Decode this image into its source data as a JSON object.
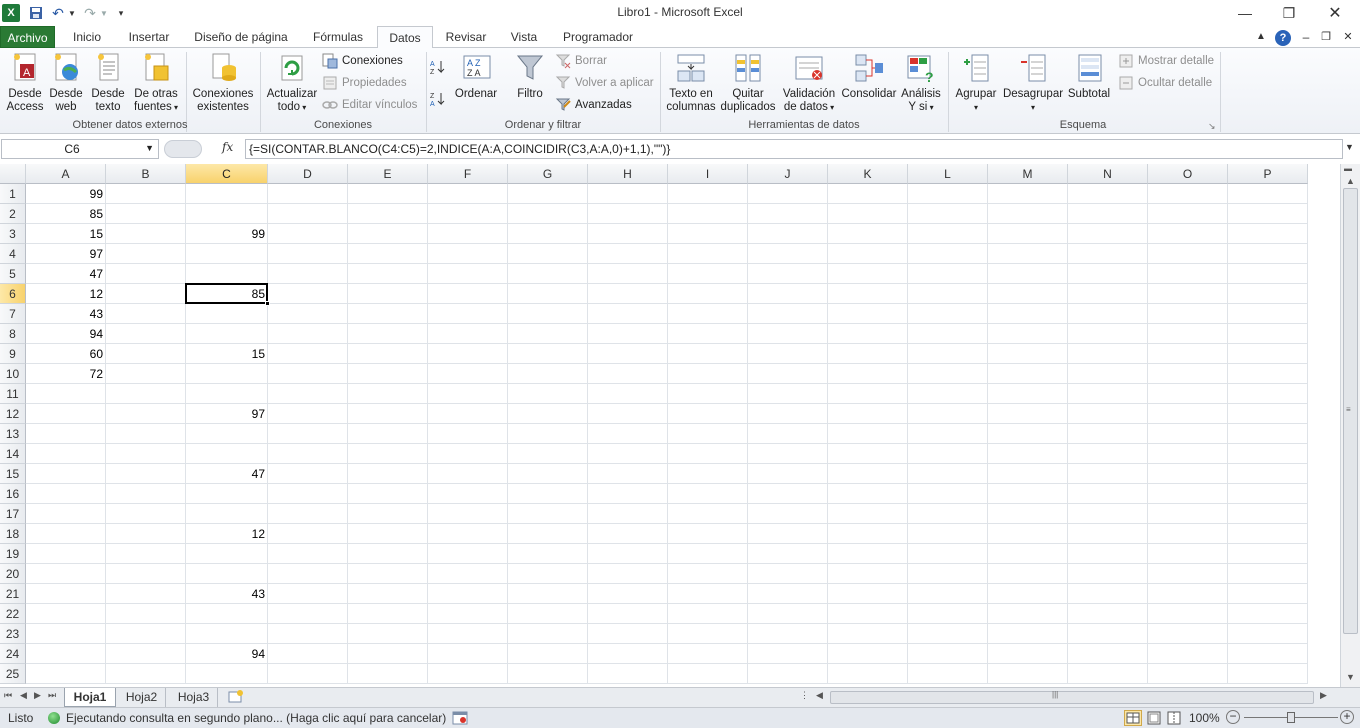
{
  "window": {
    "title": "Libro1  -  Microsoft Excel"
  },
  "tabs": [
    "Archivo",
    "Inicio",
    "Insertar",
    "Diseño de página",
    "Fórmulas",
    "Datos",
    "Revisar",
    "Vista",
    "Programador"
  ],
  "ribbon": {
    "ext": {
      "access_l1": "Desde",
      "access_l2": "Access",
      "web_l1": "Desde",
      "web_l2": "web",
      "text_l1": "Desde",
      "text_l2": "texto",
      "other_l1": "De otras",
      "other_l2": "fuentes",
      "existing_l1": "Conexiones",
      "existing_l2": "existentes",
      "label": "Obtener datos externos"
    },
    "conn": {
      "refresh_l1": "Actualizar",
      "refresh_l2": "todo",
      "connections": "Conexiones",
      "properties": "Propiedades",
      "edit_links": "Editar vínculos",
      "label": "Conexiones"
    },
    "sort": {
      "sort": "Ordenar",
      "filter": "Filtro",
      "clear": "Borrar",
      "reapply": "Volver a aplicar",
      "advanced": "Avanzadas",
      "label": "Ordenar y filtrar"
    },
    "tools": {
      "t2c_l1": "Texto en",
      "t2c_l2": "columnas",
      "dup_l1": "Quitar",
      "dup_l2": "duplicados",
      "val_l1": "Validación",
      "val_l2": "de datos",
      "consolidate": "Consolidar",
      "whatif_l1": "Análisis",
      "whatif_l2": "Y si",
      "label": "Herramientas de datos"
    },
    "outline": {
      "group": "Agrupar",
      "ungroup": "Desagrupar",
      "subtotal": "Subtotal",
      "show": "Mostrar detalle",
      "hide": "Ocultar detalle",
      "label": "Esquema"
    }
  },
  "formula_bar": {
    "name_box": "C6",
    "fx": "fx",
    "formula": "{=SI(CONTAR.BLANCO(C4:C5)=2,INDICE(A:A,COINCIDIR(C3,A:A,0)+1,1),\"\")}"
  },
  "grid": {
    "columns": [
      "A",
      "B",
      "C",
      "D",
      "E",
      "F",
      "G",
      "H",
      "I",
      "J",
      "K",
      "L",
      "M",
      "N",
      "O",
      "P"
    ],
    "rows": [
      "1",
      "2",
      "3",
      "4",
      "5",
      "6",
      "7",
      "8",
      "9",
      "10",
      "11",
      "12",
      "13",
      "14",
      "15",
      "16",
      "17",
      "18",
      "19",
      "20",
      "21",
      "22",
      "23",
      "24",
      "25"
    ],
    "colA": [
      "99",
      "85",
      "15",
      "97",
      "47",
      "12",
      "43",
      "94",
      "60",
      "72",
      "",
      "",
      "",
      "",
      "",
      "",
      "",
      "",
      "",
      "",
      "",
      "",
      "",
      "",
      ""
    ],
    "colC": [
      "",
      "",
      "99",
      "",
      "",
      "85",
      "",
      "",
      "15",
      "",
      "",
      "97",
      "",
      "",
      "47",
      "",
      "",
      "12",
      "",
      "",
      "43",
      "",
      "",
      "94",
      ""
    ],
    "selected_cell": "C6"
  },
  "sheets": [
    "Hoja1",
    "Hoja2",
    "Hoja3"
  ],
  "status": {
    "mode": "Listo",
    "message": "Ejecutando consulta en segundo plano... (Haga clic aquí para cancelar)",
    "zoom": "100%"
  },
  "colors": {
    "file_tab": "#2a7a34",
    "selection_header": "#f8d26c",
    "accent_blue": "#1f5fb4"
  }
}
